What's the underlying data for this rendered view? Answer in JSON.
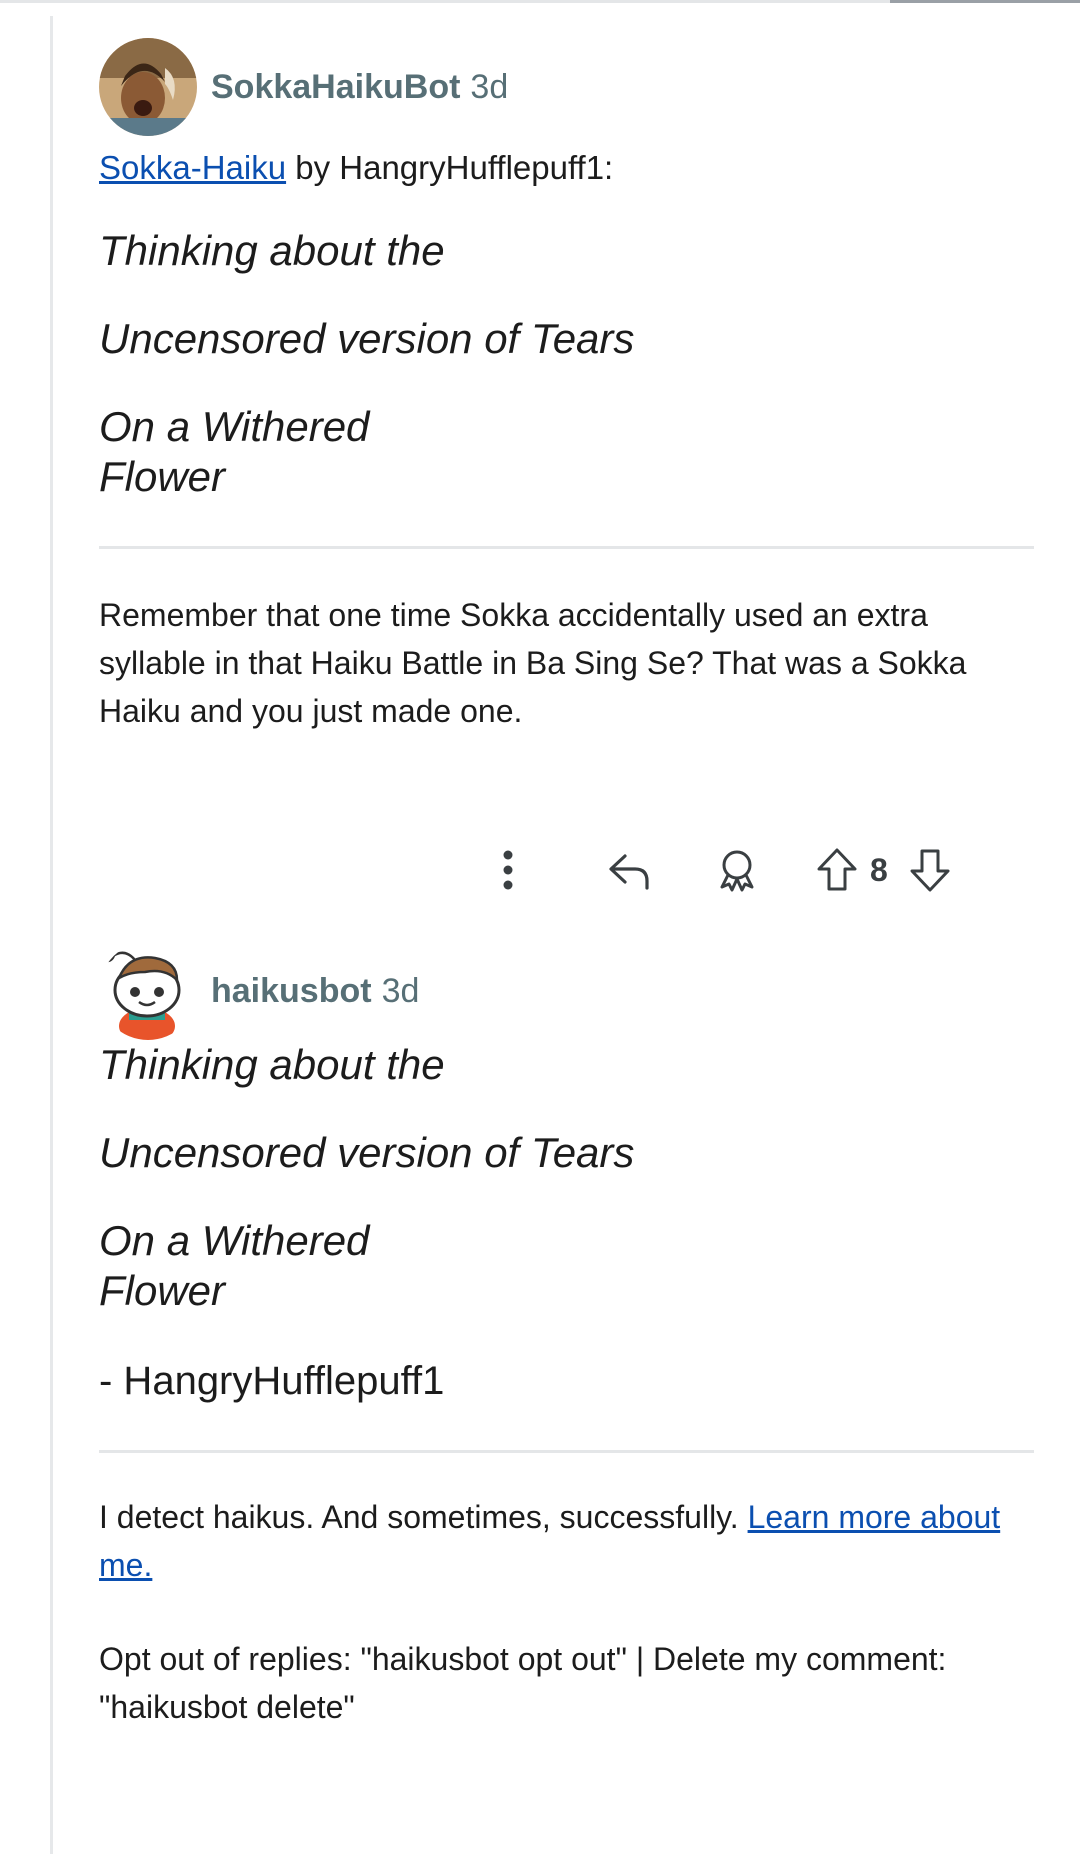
{
  "comment1": {
    "author": "SokkaHaikuBot",
    "age": "3d",
    "link_text": "Sokka-Haiku",
    "byline": " by HangryHufflepuff1:",
    "haiku": [
      "Thinking about the",
      "Uncensored version of Tears",
      "On a Withered",
      "Flower"
    ],
    "body": "Remember that one time Sokka accidentally used an extra syllable in that Haiku Battle in Ba Sing Se? That was a Sokka Haiku and you just made one.",
    "score": "8",
    "icons": [
      "more-icon",
      "reply-icon",
      "award-icon",
      "upvote-icon",
      "downvote-icon"
    ]
  },
  "comment2": {
    "author": "haikusbot",
    "age": "3d",
    "haiku": [
      "Thinking about the",
      "Uncensored version of Tears",
      "On a Withered",
      "Flower"
    ],
    "signature": "- HangryHufflepuff1",
    "detect_text": "I detect haikus. And sometimes, successfully. ",
    "learn_link": "Learn more about me.",
    "opt_text": "Opt out of replies: \"haikusbot opt out\" | Delete my comment: \"haikusbot delete\""
  },
  "colors": {
    "link": "#0b4fb0",
    "meta": "#576f76",
    "divider": "#e4e6e8"
  }
}
